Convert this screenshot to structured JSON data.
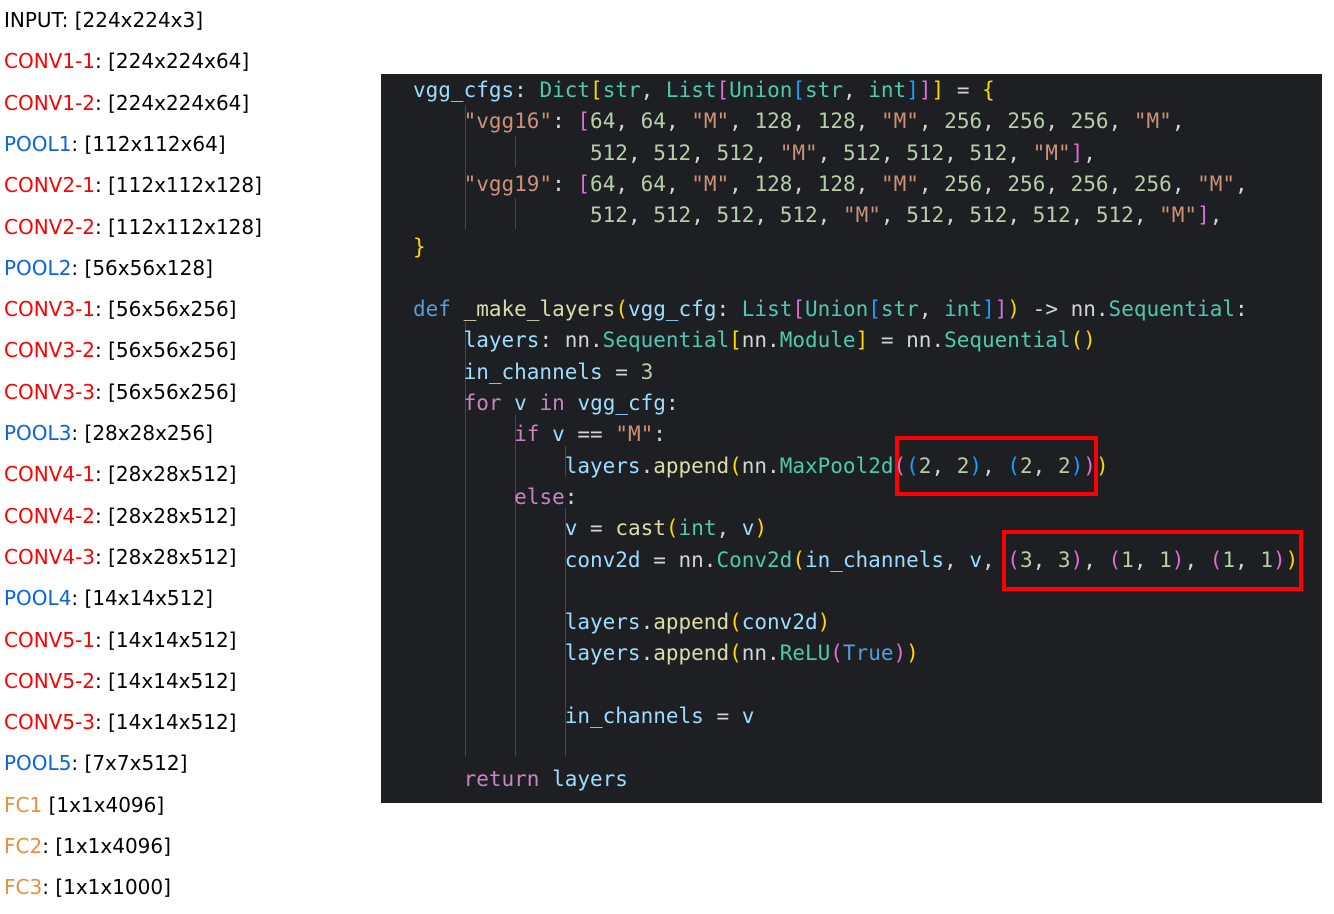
{
  "layers": [
    {
      "name": "INPUT",
      "sep": ": ",
      "shape": "[224x224x3]",
      "kind": "input"
    },
    {
      "name": "CONV1-1",
      "sep": ": ",
      "shape": "[224x224x64]",
      "kind": "conv"
    },
    {
      "name": "CONV1-2",
      "sep": ": ",
      "shape": "[224x224x64]",
      "kind": "conv"
    },
    {
      "name": "POOL1",
      "sep": ": ",
      "shape": "[112x112x64]",
      "kind": "pool"
    },
    {
      "name": "CONV2-1",
      "sep": ": ",
      "shape": "[112x112x128]",
      "kind": "conv"
    },
    {
      "name": "CONV2-2",
      "sep": ": ",
      "shape": "[112x112x128]",
      "kind": "conv"
    },
    {
      "name": "POOL2",
      "sep": ": ",
      "shape": "[56x56x128]",
      "kind": "pool"
    },
    {
      "name": "CONV3-1",
      "sep": ": ",
      "shape": "[56x56x256]",
      "kind": "conv"
    },
    {
      "name": "CONV3-2",
      "sep": ": ",
      "shape": "[56x56x256]",
      "kind": "conv"
    },
    {
      "name": "CONV3-3",
      "sep": ": ",
      "shape": "[56x56x256]",
      "kind": "conv"
    },
    {
      "name": "POOL3",
      "sep": ": ",
      "shape": "[28x28x256]",
      "kind": "pool"
    },
    {
      "name": "CONV4-1",
      "sep": ": ",
      "shape": "[28x28x512]",
      "kind": "conv"
    },
    {
      "name": "CONV4-2",
      "sep": ": ",
      "shape": "[28x28x512]",
      "kind": "conv"
    },
    {
      "name": "CONV4-3",
      "sep": ": ",
      "shape": "[28x28x512]",
      "kind": "conv"
    },
    {
      "name": "POOL4",
      "sep": ": ",
      "shape": "[14x14x512]",
      "kind": "pool"
    },
    {
      "name": "CONV5-1",
      "sep": ": ",
      "shape": "[14x14x512]",
      "kind": "conv"
    },
    {
      "name": "CONV5-2",
      "sep": ": ",
      "shape": "[14x14x512]",
      "kind": "conv"
    },
    {
      "name": "CONV5-3",
      "sep": ": ",
      "shape": "[14x14x512]",
      "kind": "conv"
    },
    {
      "name": "POOL5",
      "sep": ": ",
      "shape": "[7x7x512]",
      "kind": "pool"
    },
    {
      "name": "FC1",
      "sep": " ",
      "shape": "[1x1x4096]",
      "kind": "fc"
    },
    {
      "name": "FC2",
      "sep": ": ",
      "shape": "[1x1x4096]",
      "kind": "fc"
    },
    {
      "name": "FC3",
      "sep": ": ",
      "shape": "[1x1x1000]",
      "kind": "fc"
    }
  ],
  "code": {
    "lines": [
      [
        [
          "var",
          "vgg_cfgs"
        ],
        [
          "op",
          ": "
        ],
        [
          "ty",
          "Dict"
        ],
        [
          "b1",
          "["
        ],
        [
          "ty",
          "str"
        ],
        [
          "op",
          ", "
        ],
        [
          "ty",
          "List"
        ],
        [
          "b2",
          "["
        ],
        [
          "ty",
          "Union"
        ],
        [
          "b3",
          "["
        ],
        [
          "ty",
          "str"
        ],
        [
          "op",
          ", "
        ],
        [
          "ty",
          "int"
        ],
        [
          "b3",
          "]"
        ],
        [
          "b2",
          "]"
        ],
        [
          "b1",
          "]"
        ],
        [
          "op",
          " = "
        ],
        [
          "b1",
          "{"
        ]
      ],
      [
        [
          "op",
          "    "
        ],
        [
          "str",
          "\"vgg16\""
        ],
        [
          "op",
          ": "
        ],
        [
          "b2",
          "["
        ],
        [
          "num",
          "64"
        ],
        [
          "op",
          ", "
        ],
        [
          "num",
          "64"
        ],
        [
          "op",
          ", "
        ],
        [
          "str",
          "\"M\""
        ],
        [
          "op",
          ", "
        ],
        [
          "num",
          "128"
        ],
        [
          "op",
          ", "
        ],
        [
          "num",
          "128"
        ],
        [
          "op",
          ", "
        ],
        [
          "str",
          "\"M\""
        ],
        [
          "op",
          ", "
        ],
        [
          "num",
          "256"
        ],
        [
          "op",
          ", "
        ],
        [
          "num",
          "256"
        ],
        [
          "op",
          ", "
        ],
        [
          "num",
          "256"
        ],
        [
          "op",
          ", "
        ],
        [
          "str",
          "\"M\""
        ],
        [
          "op",
          ","
        ]
      ],
      [
        [
          "op",
          "              "
        ],
        [
          "num",
          "512"
        ],
        [
          "op",
          ", "
        ],
        [
          "num",
          "512"
        ],
        [
          "op",
          ", "
        ],
        [
          "num",
          "512"
        ],
        [
          "op",
          ", "
        ],
        [
          "str",
          "\"M\""
        ],
        [
          "op",
          ", "
        ],
        [
          "num",
          "512"
        ],
        [
          "op",
          ", "
        ],
        [
          "num",
          "512"
        ],
        [
          "op",
          ", "
        ],
        [
          "num",
          "512"
        ],
        [
          "op",
          ", "
        ],
        [
          "str",
          "\"M\""
        ],
        [
          "b2",
          "]"
        ],
        [
          "op",
          ","
        ]
      ],
      [
        [
          "op",
          "    "
        ],
        [
          "str",
          "\"vgg19\""
        ],
        [
          "op",
          ": "
        ],
        [
          "b2",
          "["
        ],
        [
          "num",
          "64"
        ],
        [
          "op",
          ", "
        ],
        [
          "num",
          "64"
        ],
        [
          "op",
          ", "
        ],
        [
          "str",
          "\"M\""
        ],
        [
          "op",
          ", "
        ],
        [
          "num",
          "128"
        ],
        [
          "op",
          ", "
        ],
        [
          "num",
          "128"
        ],
        [
          "op",
          ", "
        ],
        [
          "str",
          "\"M\""
        ],
        [
          "op",
          ", "
        ],
        [
          "num",
          "256"
        ],
        [
          "op",
          ", "
        ],
        [
          "num",
          "256"
        ],
        [
          "op",
          ", "
        ],
        [
          "num",
          "256"
        ],
        [
          "op",
          ", "
        ],
        [
          "num",
          "256"
        ],
        [
          "op",
          ", "
        ],
        [
          "str",
          "\"M\""
        ],
        [
          "op",
          ","
        ]
      ],
      [
        [
          "op",
          "              "
        ],
        [
          "num",
          "512"
        ],
        [
          "op",
          ", "
        ],
        [
          "num",
          "512"
        ],
        [
          "op",
          ", "
        ],
        [
          "num",
          "512"
        ],
        [
          "op",
          ", "
        ],
        [
          "num",
          "512"
        ],
        [
          "op",
          ", "
        ],
        [
          "str",
          "\"M\""
        ],
        [
          "op",
          ", "
        ],
        [
          "num",
          "512"
        ],
        [
          "op",
          ", "
        ],
        [
          "num",
          "512"
        ],
        [
          "op",
          ", "
        ],
        [
          "num",
          "512"
        ],
        [
          "op",
          ", "
        ],
        [
          "num",
          "512"
        ],
        [
          "op",
          ", "
        ],
        [
          "str",
          "\"M\""
        ],
        [
          "b2",
          "]"
        ],
        [
          "op",
          ","
        ]
      ],
      [
        [
          "b1",
          "}"
        ]
      ],
      [],
      [
        [
          "kw2",
          "def"
        ],
        [
          "op",
          " "
        ],
        [
          "fn",
          "_make_layers"
        ],
        [
          "b1",
          "("
        ],
        [
          "var",
          "vgg_cfg"
        ],
        [
          "op",
          ": "
        ],
        [
          "ty",
          "List"
        ],
        [
          "b2",
          "["
        ],
        [
          "ty",
          "Union"
        ],
        [
          "b3",
          "["
        ],
        [
          "ty",
          "str"
        ],
        [
          "op",
          ", "
        ],
        [
          "ty",
          "int"
        ],
        [
          "b3",
          "]"
        ],
        [
          "b2",
          "]"
        ],
        [
          "b1",
          ")"
        ],
        [
          "op",
          " -> "
        ],
        [
          "op",
          "nn."
        ],
        [
          "ty",
          "Sequential"
        ],
        [
          "op",
          ":"
        ]
      ],
      [
        [
          "op",
          "    "
        ],
        [
          "var",
          "layers"
        ],
        [
          "op",
          ": "
        ],
        [
          "op",
          "nn."
        ],
        [
          "ty",
          "Sequential"
        ],
        [
          "b1",
          "["
        ],
        [
          "op",
          "nn."
        ],
        [
          "ty",
          "Module"
        ],
        [
          "b1",
          "]"
        ],
        [
          "op",
          " = "
        ],
        [
          "op",
          "nn."
        ],
        [
          "ty",
          "Sequential"
        ],
        [
          "b1",
          "()"
        ]
      ],
      [
        [
          "op",
          "    "
        ],
        [
          "var",
          "in_channels"
        ],
        [
          "op",
          " = "
        ],
        [
          "num",
          "3"
        ]
      ],
      [
        [
          "op",
          "    "
        ],
        [
          "kw",
          "for"
        ],
        [
          "op",
          " "
        ],
        [
          "var",
          "v"
        ],
        [
          "op",
          " "
        ],
        [
          "kw",
          "in"
        ],
        [
          "op",
          " "
        ],
        [
          "var",
          "vgg_cfg"
        ],
        [
          "op",
          ":"
        ]
      ],
      [
        [
          "op",
          "        "
        ],
        [
          "kw",
          "if"
        ],
        [
          "op",
          " "
        ],
        [
          "var",
          "v"
        ],
        [
          "op",
          " == "
        ],
        [
          "str",
          "\"M\""
        ],
        [
          "op",
          ":"
        ]
      ],
      [
        [
          "op",
          "            "
        ],
        [
          "var",
          "layers"
        ],
        [
          "op",
          "."
        ],
        [
          "fn",
          "append"
        ],
        [
          "b1",
          "("
        ],
        [
          "op",
          "nn."
        ],
        [
          "ty",
          "MaxPool2d"
        ],
        [
          "b2",
          "("
        ],
        [
          "b3",
          "("
        ],
        [
          "num",
          "2"
        ],
        [
          "op",
          ", "
        ],
        [
          "num",
          "2"
        ],
        [
          "b3",
          ")"
        ],
        [
          "op",
          ", "
        ],
        [
          "b3",
          "("
        ],
        [
          "num",
          "2"
        ],
        [
          "op",
          ", "
        ],
        [
          "num",
          "2"
        ],
        [
          "b3",
          ")"
        ],
        [
          "b2",
          ")"
        ],
        [
          "b1",
          ")"
        ]
      ],
      [
        [
          "op",
          "        "
        ],
        [
          "kw",
          "else"
        ],
        [
          "op",
          ":"
        ]
      ],
      [
        [
          "op",
          "            "
        ],
        [
          "var",
          "v"
        ],
        [
          "op",
          " = "
        ],
        [
          "fn",
          "cast"
        ],
        [
          "b1",
          "("
        ],
        [
          "ty",
          "int"
        ],
        [
          "op",
          ", "
        ],
        [
          "var",
          "v"
        ],
        [
          "b1",
          ")"
        ]
      ],
      [
        [
          "op",
          "            "
        ],
        [
          "var",
          "conv2d"
        ],
        [
          "op",
          " = "
        ],
        [
          "op",
          "nn."
        ],
        [
          "ty",
          "Conv2d"
        ],
        [
          "b1",
          "("
        ],
        [
          "var",
          "in_channels"
        ],
        [
          "op",
          ", "
        ],
        [
          "var",
          "v"
        ],
        [
          "op",
          ", "
        ],
        [
          "b2",
          "("
        ],
        [
          "num",
          "3"
        ],
        [
          "op",
          ", "
        ],
        [
          "num",
          "3"
        ],
        [
          "b2",
          ")"
        ],
        [
          "op",
          ", "
        ],
        [
          "b2",
          "("
        ],
        [
          "num",
          "1"
        ],
        [
          "op",
          ", "
        ],
        [
          "num",
          "1"
        ],
        [
          "b2",
          ")"
        ],
        [
          "op",
          ", "
        ],
        [
          "b2",
          "("
        ],
        [
          "num",
          "1"
        ],
        [
          "op",
          ", "
        ],
        [
          "num",
          "1"
        ],
        [
          "b2",
          ")"
        ],
        [
          "b1",
          ")"
        ]
      ],
      [],
      [
        [
          "op",
          "            "
        ],
        [
          "var",
          "layers"
        ],
        [
          "op",
          "."
        ],
        [
          "fn",
          "append"
        ],
        [
          "b1",
          "("
        ],
        [
          "var",
          "conv2d"
        ],
        [
          "b1",
          ")"
        ]
      ],
      [
        [
          "op",
          "            "
        ],
        [
          "var",
          "layers"
        ],
        [
          "op",
          "."
        ],
        [
          "fn",
          "append"
        ],
        [
          "b1",
          "("
        ],
        [
          "op",
          "nn."
        ],
        [
          "ty",
          "ReLU"
        ],
        [
          "b2",
          "("
        ],
        [
          "kw2",
          "True"
        ],
        [
          "b2",
          ")"
        ],
        [
          "b1",
          ")"
        ]
      ],
      [],
      [
        [
          "op",
          "            "
        ],
        [
          "var",
          "in_channels"
        ],
        [
          "op",
          " = "
        ],
        [
          "var",
          "v"
        ]
      ],
      [],
      [
        [
          "op",
          "    "
        ],
        [
          "kw",
          "return"
        ],
        [
          "op",
          " "
        ],
        [
          "var",
          "layers"
        ]
      ]
    ]
  }
}
